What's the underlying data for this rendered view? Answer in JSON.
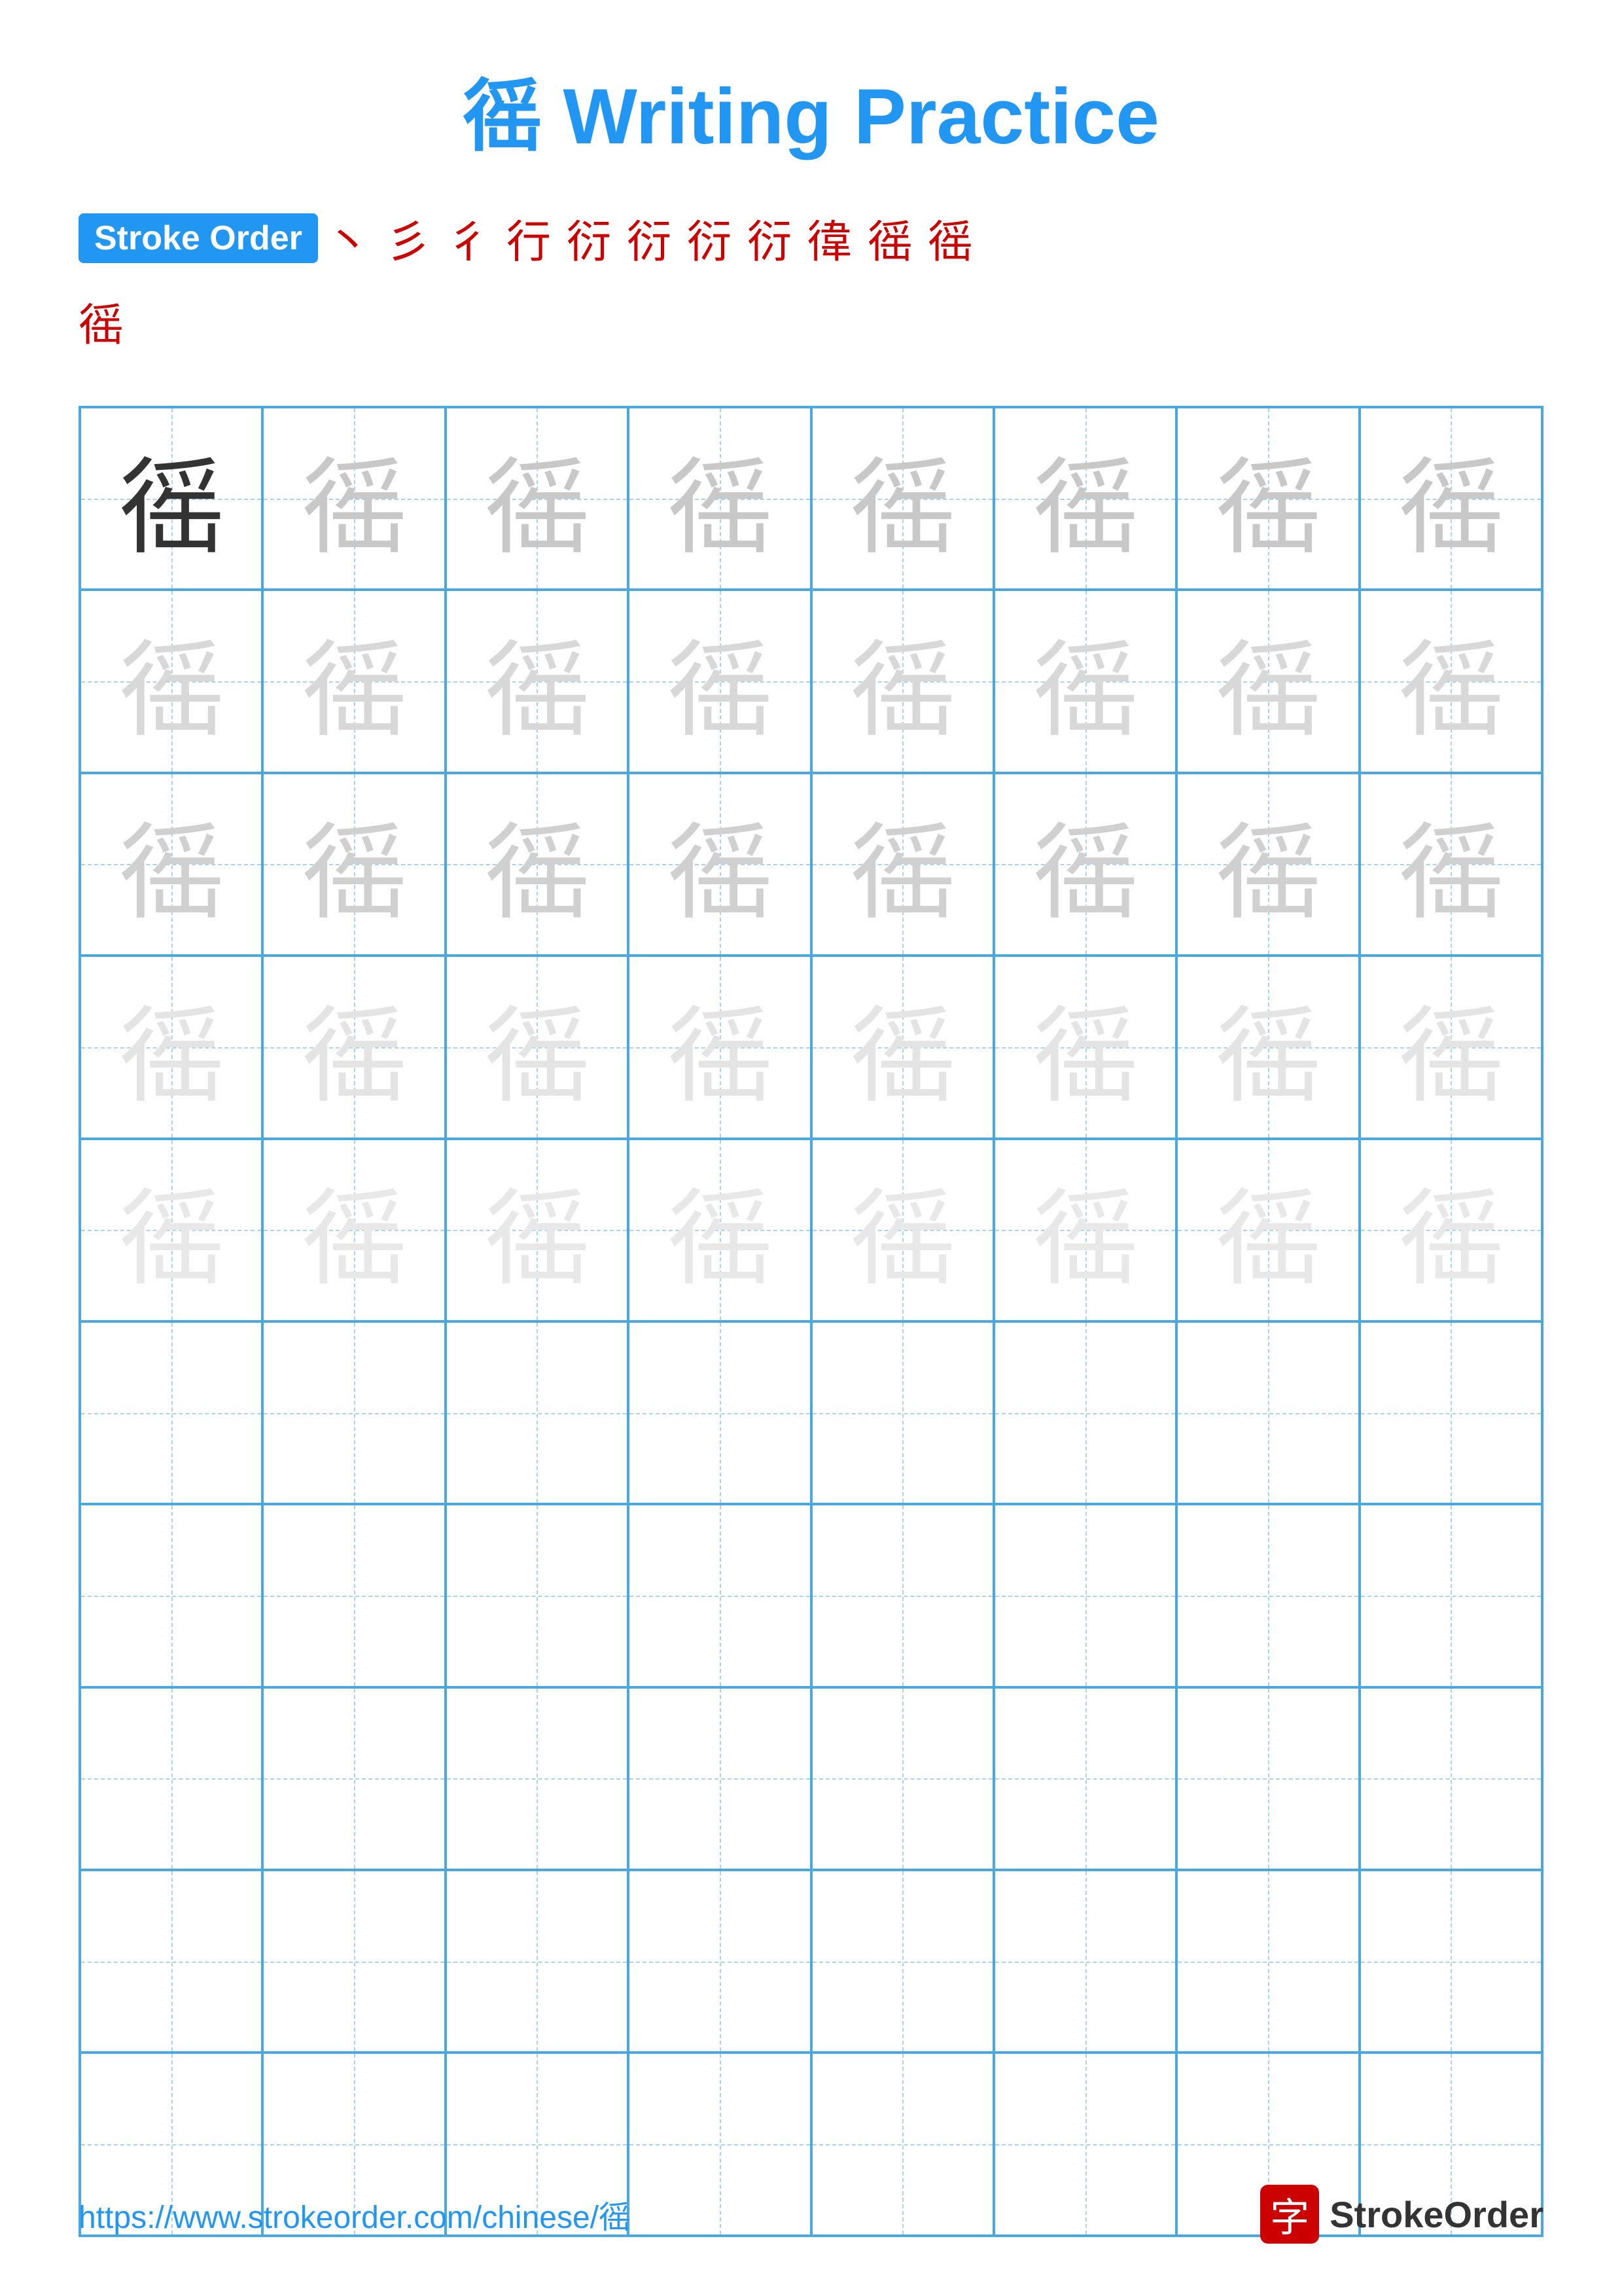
{
  "title": {
    "character": "徭",
    "label": "Writing Practice",
    "full": "徭 Writing Practice"
  },
  "stroke_order": {
    "badge_label": "Stroke Order",
    "strokes": [
      "丶",
      "彡",
      "彳",
      "行",
      "衍",
      "衍",
      "衍",
      "衍",
      "徫",
      "徭",
      "徭"
    ],
    "final_char": "徭"
  },
  "grid": {
    "character": "徭",
    "rows": 10,
    "cols": 8,
    "practice_rows_with_char": 5,
    "practice_rows_empty": 5
  },
  "footer": {
    "url": "https://www.strokeorder.com/chinese/徭",
    "logo_char": "字",
    "logo_name": "StrokeOrder"
  }
}
